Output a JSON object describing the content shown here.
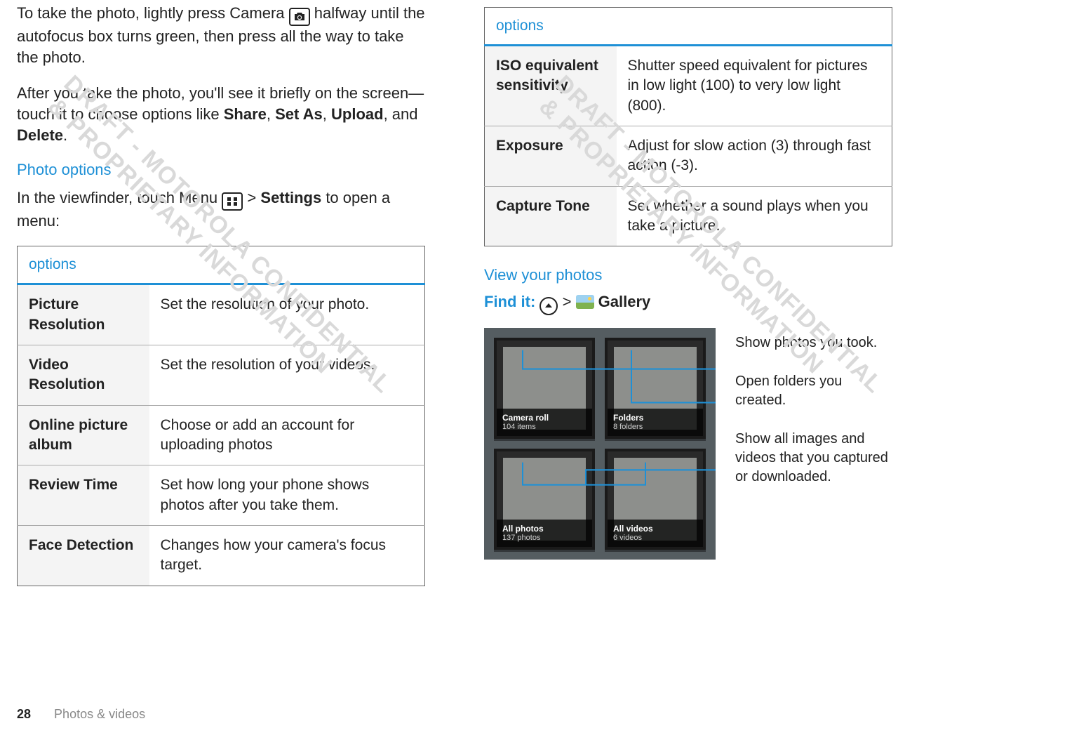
{
  "watermark": "DRAFT - MOTOROLA CONFIDENTIAL\n& PROPRIETARY INFORMATION",
  "left": {
    "p1_a": "To take the photo, lightly press Camera ",
    "p1_b": " halfway until the autofocus box turns green, then press all the way to take the photo.",
    "p2_a": "After you take the photo, you'll see it briefly on the screen—touch it to choose options like ",
    "p2_b1": "Share",
    "p2_c1": ", ",
    "p2_b2": "Set As",
    "p2_c2": ", ",
    "p2_b3": "Upload",
    "p2_c3": ", and ",
    "p2_b4": "Delete",
    "p2_c4": ".",
    "photo_options_head": "Photo options",
    "p3_a": "In the viewfinder, touch Menu ",
    "p3_b": " > ",
    "p3_settings": "Settings",
    "p3_c": " to open a menu:",
    "table_header": "options",
    "rows": [
      {
        "name": "Picture Resolution",
        "desc": "Set the resolution of your photo."
      },
      {
        "name": "Video Resolution",
        "desc": "Set the resolution of your videos."
      },
      {
        "name": "Online picture album",
        "desc": "Choose or add an account for uploading photos"
      },
      {
        "name": "Review Time",
        "desc": "Set how long your phone shows photos after you take them."
      },
      {
        "name": "Face Detection",
        "desc": "Changes how your camera's focus target."
      }
    ]
  },
  "right": {
    "table_header": "options",
    "rows": [
      {
        "name": "ISO equivalent sensitivity",
        "desc": "Shutter speed equivalent for pictures in low light (100) to very low light (800)."
      },
      {
        "name": "Exposure",
        "desc": "Adjust for slow action (3) through fast action (-3)."
      },
      {
        "name": "Capture Tone",
        "desc": "Set whether a sound plays when you take a picture."
      }
    ],
    "view_head": "View your photos",
    "findit_label": "Find it:",
    "findit_sep": " > ",
    "findit_app": "Gallery",
    "tiles": [
      {
        "title": "Camera roll",
        "sub": "104 items"
      },
      {
        "title": "Folders",
        "sub": "8 folders"
      },
      {
        "title": "All photos",
        "sub": "137 photos"
      },
      {
        "title": "All videos",
        "sub": "6 videos"
      }
    ],
    "annot1": "Show photos you took.",
    "annot2": "Open folders you created.",
    "annot3": "Show all images and videos that you captured or downloaded."
  },
  "footer": {
    "page": "28",
    "section": "Photos & videos"
  }
}
